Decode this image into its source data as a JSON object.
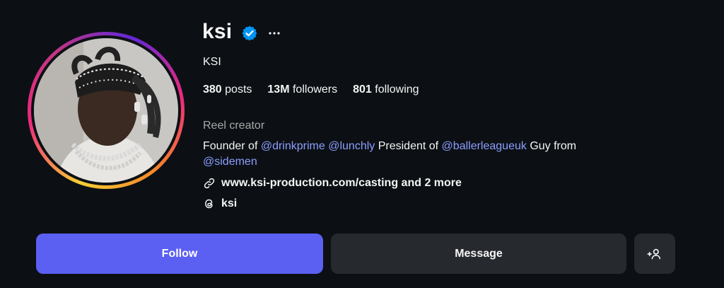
{
  "profile": {
    "username": "ksi",
    "full_name": "KSI",
    "stats": {
      "posts_count": "380",
      "posts_label": "posts",
      "followers_count": "13M",
      "followers_label": "followers",
      "following_count": "801",
      "following_label": "following"
    },
    "category": "Reel creator",
    "bio": {
      "t1": "Founder of ",
      "m1": "@drinkprime",
      "t2": " ",
      "m2": "@lunchly",
      "t3": " President of ",
      "m3": "@ballerleagueuk",
      "t4": " Guy from ",
      "m4": "@sidemen"
    },
    "link_text": "www.ksi-production.com/casting and 2 more",
    "threads_handle": "ksi"
  },
  "actions": {
    "follow_label": "Follow",
    "message_label": "Message"
  },
  "icons": {
    "verified": "verified-badge-icon",
    "more": "more-options-icon",
    "link": "link-icon",
    "threads": "threads-icon",
    "add_user": "add-user-icon"
  },
  "colors": {
    "background": "#0c1014",
    "accent_button": "#5b5ff2",
    "secondary_button": "#26292d",
    "mention": "#8c9eff",
    "verified": "#0095f6",
    "muted_text": "#a8a8a8"
  }
}
